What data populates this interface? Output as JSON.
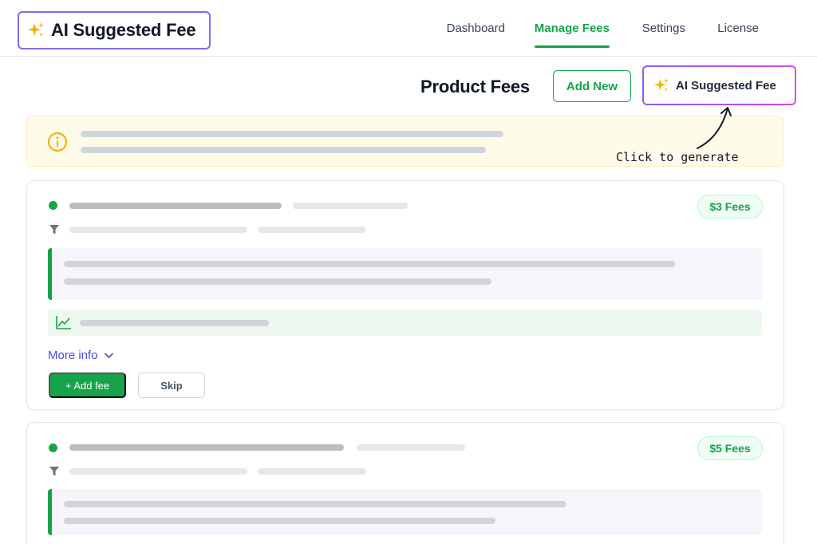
{
  "brand": {
    "title": "AI Suggested Fee",
    "icon": "sparkles-icon"
  },
  "nav": {
    "items": [
      {
        "label": "Dashboard",
        "active": false
      },
      {
        "label": "Manage Fees",
        "active": true
      },
      {
        "label": "Settings",
        "active": false
      },
      {
        "label": "License",
        "active": false
      }
    ]
  },
  "toolbar": {
    "page_title": "Product Fees",
    "add_new_label": "Add New",
    "ai_button_label": "AI Suggested Fee"
  },
  "banner": {
    "icon": "info-icon"
  },
  "callout": {
    "text": "Click to generate"
  },
  "cards": [
    {
      "fee_badge": "$3 Fees",
      "more_info_label": "More info",
      "add_fee_label": "+ Add fee",
      "skip_label": "Skip"
    },
    {
      "fee_badge": "$5 Fees"
    }
  ],
  "colors": {
    "accent_green": "#16a34a",
    "brand_purple": "#7c6cf2",
    "link_indigo": "#4f46e5",
    "banner_bg": "#fefbe8",
    "warning_amber": "#f5b301"
  }
}
